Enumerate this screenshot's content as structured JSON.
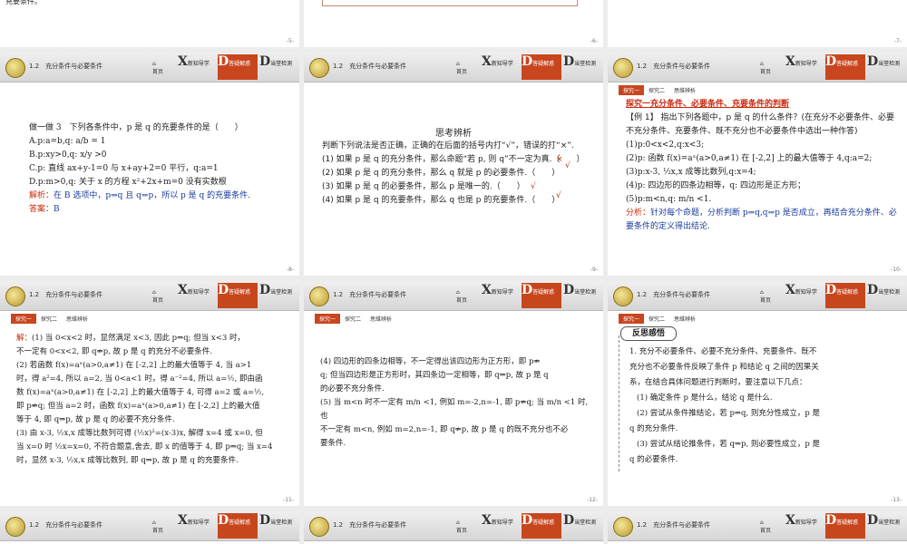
{
  "header": {
    "section": "1.2　充分条件与必要条件",
    "home": "首页",
    "nav": [
      {
        "big": "X",
        "label": "新知导学",
        "sub": "XINZHIDAOXUE"
      },
      {
        "big": "D",
        "label": "答疑解惑",
        "sub": "DAYIJIEHUO"
      },
      {
        "big": "D",
        "label": "当堂检测",
        "sub": "DANGTANGJIANCE"
      }
    ]
  },
  "tabs": [
    "探究一",
    "探究二",
    "思维辨析"
  ],
  "top_row": {
    "left_text": "充要条件。",
    "pages": [
      "-5-",
      "-6-",
      "-7-"
    ]
  },
  "slide8": {
    "title": "做一做 3　下列各条件中，p 是 q 的充要条件的是（　　）",
    "a": "A.p:a=b,q: a/b = 1",
    "b": "B.p:xy>0,q: x/y >0",
    "c": "C.p: 直线 ax+y-1=0 与 x+ay+2=0 平行，q:a=1",
    "d": "D.p:m>0,q: 关于 x 的方程 x²+2x+m=0 没有实数根",
    "analysis_label": "解析：",
    "analysis": "在 B 选项中，p⇒q 且 q⇒p，所以 p 是 q 的充要条件.",
    "answer_label": "答案：",
    "answer": "B",
    "page": "-8-"
  },
  "slide9": {
    "title": "思考辨析",
    "intro": "判断下列说法是否正确，正确的在后面的括号内打“√”，错误的打“×”.",
    "items": [
      "(1) 如果 p 是 q 的充分条件，那么命题“若 p, 则 q”不一定为真.（　　）",
      "(2) 如果 p 是 q 的充分条件，那么 q 就是 p 的必要条件.（　　）",
      "(3) 如果 p 是 q 的必要条件，那么 p 是唯一的.（　　）",
      "(4) 如果 p 是 q 的充要条件，那么 q 也是 p 的充要条件.（　　）"
    ],
    "marks": [
      "×",
      "√",
      "√",
      "√"
    ],
    "page": "-9-"
  },
  "slide10": {
    "title": "探究一充分条件、必要条件、充要条件的判断",
    "example": "【例 1】 指出下列各题中，p 是 q 的什么条件？(在充分不必要条件、必要不充分条件、充要条件、既不充分也不必要条件中选出一种作答)",
    "items": [
      "(1)p:0<x<2,q:x<3;",
      "(2)p: 函数 f(x)=aˣ(a>0,a≠1) 在 [-2,2] 上的最大值等于 4,q:a=2;",
      "(3)p:x-3, ½x,x 成等比数列,q:x=4;",
      "(4)p: 四边形的四条边相等，q: 四边形是正方形；",
      "(5)p:m<n,q: m/n <1."
    ],
    "analysis_label": "分析：",
    "analysis": "针对每个命题，分析判断 p⇒q,q⇒p 是否成立，再结合充分条件、必要条件的定义得出结论.",
    "page": "-10-"
  },
  "slide11": {
    "label": "解：",
    "lines": [
      "(1) 当 0<x<2 时，显然满足 x<3, 因此 p⇒q; 但当 x<3 时，",
      "不一定有 0<x<2, 即 q⇏p, 故 p 是 q 的充分不必要条件.",
      "(2) 若函数 f(x)=aˣ(a>0,a≠1) 在 [-2,2] 上的最大值等于 4, 当 a>1",
      "时，得 a²=4, 所以 a=2, 当 0<a<1 时，得 a⁻²=4, 所以 a=½, 即由函",
      "数 f(x)=aˣ(a>0,a≠1) 在 [-2,2] 上的最大值等于 4, 可得 a=2 或 a=½,",
      "即 p⇏q; 但当 a=2 时，函数 f(x)=aˣ(a>0,a≠1) 在 [-2,2] 上的最大值",
      "等于 4, 即 q⇒p, 故 p 是 q 的必要不充分条件.",
      "(3) 由 x-3, ½x,x 成等比数列可得 (½x)²=(x-3)x, 解得 x=4 或 x=0, 但",
      "当 x=0 时 ½x=x=0, 不符合题意,舍去, 即 x 的值等于 4, 即 p⇒q; 当 x=4",
      "时，显然 x-3, ½x,x 成等比数列, 即 q⇒p, 故 p 是 q 的充要条件."
    ],
    "page": "-11-"
  },
  "slide12": {
    "lines": [
      "(4) 四边形的四条边相等，不一定得出该四边形为正方形，即 p⇏",
      "q; 但当四边形是正方形时，其四条边一定相等，即 q⇒p, 故 p 是 q",
      "的必要不充分条件.",
      "(5) 当 m<n 时不一定有 m/n <1, 例如 m=-2,n=-1, 即 p⇏q; 当 m/n <1 时, 也",
      "不一定有 m<n, 例如 m=2,n=-1, 即 q⇏p, 故 p 是 q 的既不充分也不必",
      "要条件."
    ],
    "page": "-12-"
  },
  "slide13": {
    "badge": "反思感悟",
    "lines": [
      "1. 充分不必要条件、必要不充分条件、充要条件、既不",
      "充分也不必要条件反映了条件 p 和结论 q 之间的因果关",
      "系，在结合具体问题进行判断时，要注意以下几点：",
      "(1) 确定条件 p 是什么，结论 q 是什么.",
      "(2) 尝试从条件推结论，若 p⇒q, 则充分性成立，p 是",
      "q 的充分条件.",
      "(3) 尝试从结论推条件，若 q⇒p, 则必要性成立，p 是",
      "q 的必要条件."
    ],
    "page": "-13-"
  },
  "colors": {
    "accent": "#c8461e",
    "red_text": "#c8280e",
    "blue_text": "#1a3c9a"
  }
}
